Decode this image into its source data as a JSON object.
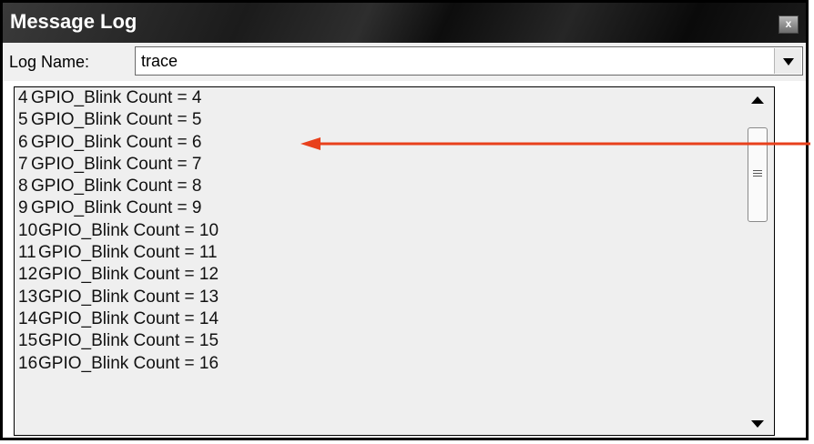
{
  "window": {
    "title": "Message Log",
    "close_glyph": "x"
  },
  "log_selector": {
    "label": "Log Name:",
    "value": "trace"
  },
  "log_lines": [
    {
      "num": "4",
      "text": "GPIO_Blink Count = 4"
    },
    {
      "num": "5",
      "text": "GPIO_Blink Count = 5"
    },
    {
      "num": "6",
      "text": "GPIO_Blink Count = 6"
    },
    {
      "num": "7",
      "text": "GPIO_Blink Count = 7"
    },
    {
      "num": "8",
      "text": "GPIO_Blink Count = 8"
    },
    {
      "num": "9",
      "text": "GPIO_Blink Count = 9"
    },
    {
      "num": "10",
      "text": "GPIO_Blink Count = 10"
    },
    {
      "num": "11",
      "text": "GPIO_Blink Count = 11"
    },
    {
      "num": "12",
      "text": "GPIO_Blink Count = 12"
    },
    {
      "num": "13",
      "text": "GPIO_Blink Count = 13"
    },
    {
      "num": "14",
      "text": "GPIO_Blink Count = 14"
    },
    {
      "num": "15",
      "text": "GPIO_Blink Count = 15"
    },
    {
      "num": "16",
      "text": "GPIO_Blink Count = 16"
    }
  ],
  "annotation": {
    "arrow_color": "#e8401c",
    "points_to_line": "5"
  },
  "colors": {
    "titlebar": "#1b1b1b",
    "list_background": "#efefef"
  }
}
